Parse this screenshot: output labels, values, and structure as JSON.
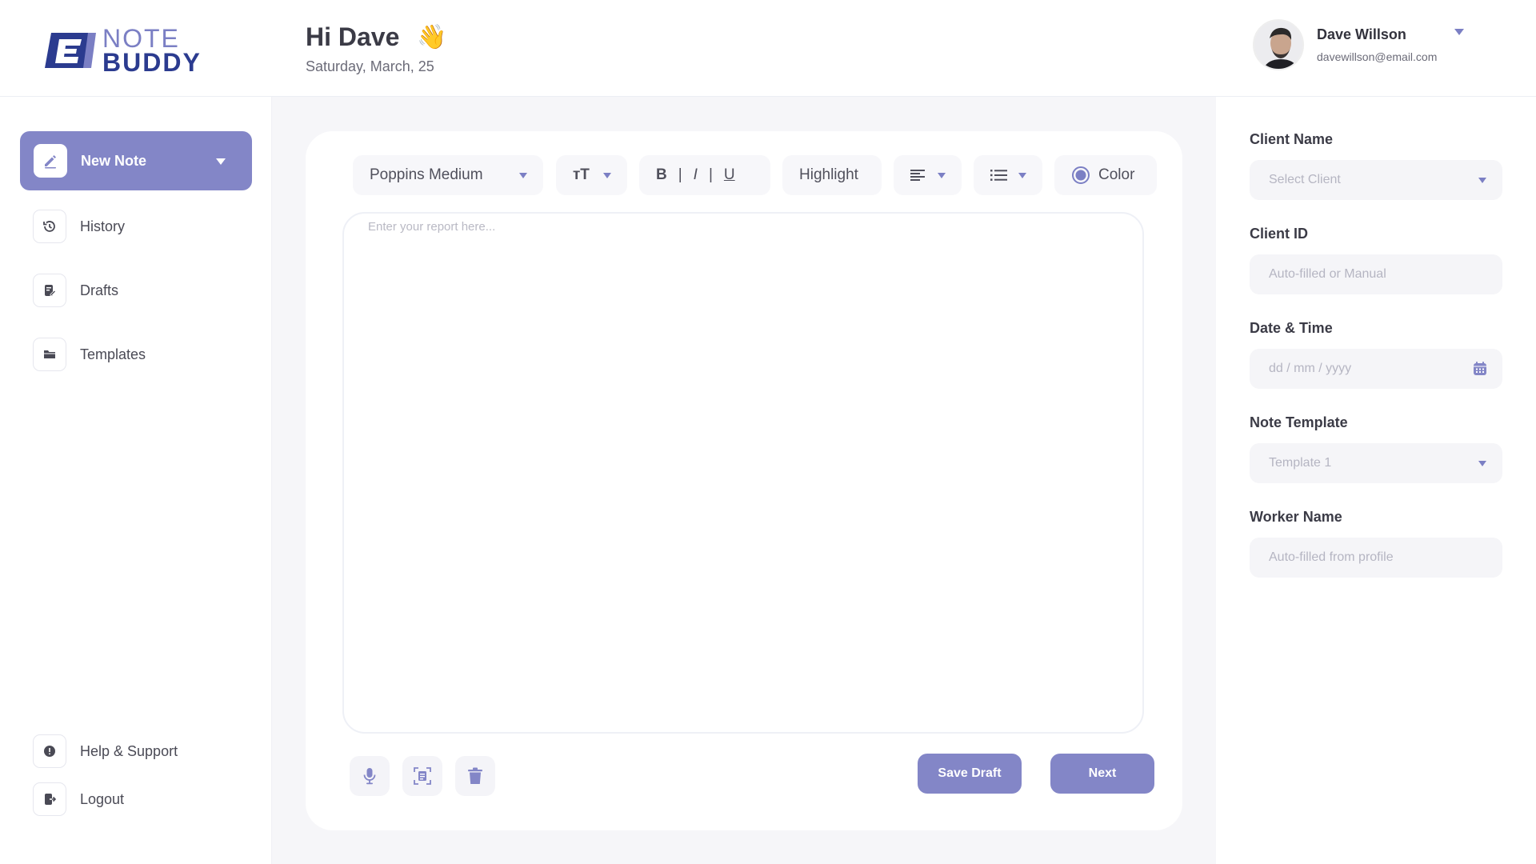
{
  "brand": {
    "line1": "NOTE",
    "line2": "BUDDY"
  },
  "greeting": {
    "title": "Hi Dave",
    "emoji": "👋",
    "date": "Saturday, March, 25"
  },
  "user": {
    "name": "Dave Willson",
    "email": "davewillson@email.com"
  },
  "sidebar": {
    "primary": {
      "label": "New Note"
    },
    "items": [
      {
        "label": "History",
        "icon": "history-icon"
      },
      {
        "label": "Drafts",
        "icon": "drafts-icon"
      },
      {
        "label": "Templates",
        "icon": "folder-icon"
      }
    ],
    "footer": [
      {
        "label": "Help & Support",
        "icon": "help-icon"
      },
      {
        "label": "Logout",
        "icon": "logout-icon"
      }
    ]
  },
  "toolbar": {
    "font": "Poppins Medium",
    "size_icon": "тT",
    "bold": "B",
    "italic": "I",
    "underline": "U",
    "highlight": "Highlight",
    "color": "Color"
  },
  "editor": {
    "placeholder": "Enter your report here..."
  },
  "actions": {
    "save_draft": "Save Draft",
    "next": "Next"
  },
  "form": {
    "client_name": {
      "label": "Client Name",
      "placeholder": "Select Client"
    },
    "client_id": {
      "label": "Client ID",
      "placeholder": "Auto-filled or Manual"
    },
    "date_time": {
      "label": "Date & Time",
      "placeholder": "dd / mm / yyyy"
    },
    "note_template": {
      "label": "Note Template",
      "value": "Template 1"
    },
    "worker_name": {
      "label": "Worker Name",
      "placeholder": "Auto-filled from profile"
    }
  },
  "colors": {
    "accent": "#8386c7",
    "brand_dark": "#2b3b8f",
    "background": "#f6f6f9"
  }
}
